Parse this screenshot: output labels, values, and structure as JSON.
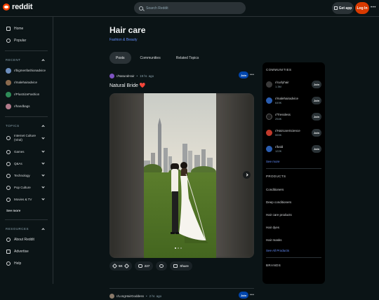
{
  "header": {
    "logo_text": "reddit",
    "search_placeholder": "Search Reddit",
    "get_app": "Get app",
    "login": "Log In",
    "more": "•••"
  },
  "sidebar": {
    "nav": [
      {
        "label": "Home",
        "icon": "home-icon"
      },
      {
        "label": "Popular",
        "icon": "popular-icon"
      }
    ],
    "recent_heading": "RECENT",
    "recent": [
      {
        "label": "r/bigmenfashionadvice",
        "color": "#6d8fbf"
      },
      {
        "label": "r/malehairadvice",
        "color": "#8b6a4d"
      },
      {
        "label": "r/PlusSizeFashion",
        "color": "#2e8b57"
      },
      {
        "label": "r/handbags",
        "color": "#b07a8a"
      }
    ],
    "topics_heading": "TOPICS",
    "topics": [
      {
        "label": "Internet Culture (Viral)"
      },
      {
        "label": "Games"
      },
      {
        "label": "Q&As"
      },
      {
        "label": "Technology"
      },
      {
        "label": "Pop Culture"
      },
      {
        "label": "Movies & TV"
      }
    ],
    "see_more": "See more",
    "resources_heading": "RESOURCES",
    "resources": [
      {
        "label": "About Reddit"
      },
      {
        "label": "Advertise"
      },
      {
        "label": "Help"
      }
    ]
  },
  "main": {
    "title": "Hair care",
    "category": "Fashion & Beauty",
    "tabs": [
      "Posts",
      "Communities",
      "Related Topics"
    ],
    "post": {
      "subreddit": "r/NaturalHair",
      "time": "19 hr. ago",
      "join": "Join",
      "title": "Natural Bride ❤️",
      "votes": "5K",
      "comments": "227",
      "share": "Share"
    },
    "next_post": {
      "subreddit": "r/LongHairGoddess",
      "time": "2 hr. ago",
      "join": "Join"
    }
  },
  "right": {
    "communities_heading": "COMMUNITIES",
    "communities": [
      {
        "name": "r/curlyhair",
        "members": "1.3M",
        "join": "Join",
        "color": "#3a3a3a"
      },
      {
        "name": "r/malehairadvice",
        "members": "649K",
        "join": "Join",
        "color": "#2a5db0"
      },
      {
        "name": "r/Tressless",
        "members": "254K",
        "join": "Join",
        "color": "#1a1a1a"
      },
      {
        "name": "r/HaircareScience",
        "members": "559K",
        "join": "Join",
        "color": "#c0392b"
      },
      {
        "name": "r/bald",
        "members": "122K",
        "join": "Join",
        "color": "#2a5db0"
      }
    ],
    "see_more": "See more",
    "products_heading": "PRODUCTS",
    "products": [
      "Conditioners",
      "Deep conditioners",
      "Hair care products",
      "Hair dyes",
      "Hair masks"
    ],
    "see_all_products": "See All Products",
    "brands_heading": "BRANDS"
  },
  "colors": {
    "accent": "#ff4500",
    "login_bg": "#d93a00",
    "link": "#648efc",
    "join": "#0045ac"
  }
}
